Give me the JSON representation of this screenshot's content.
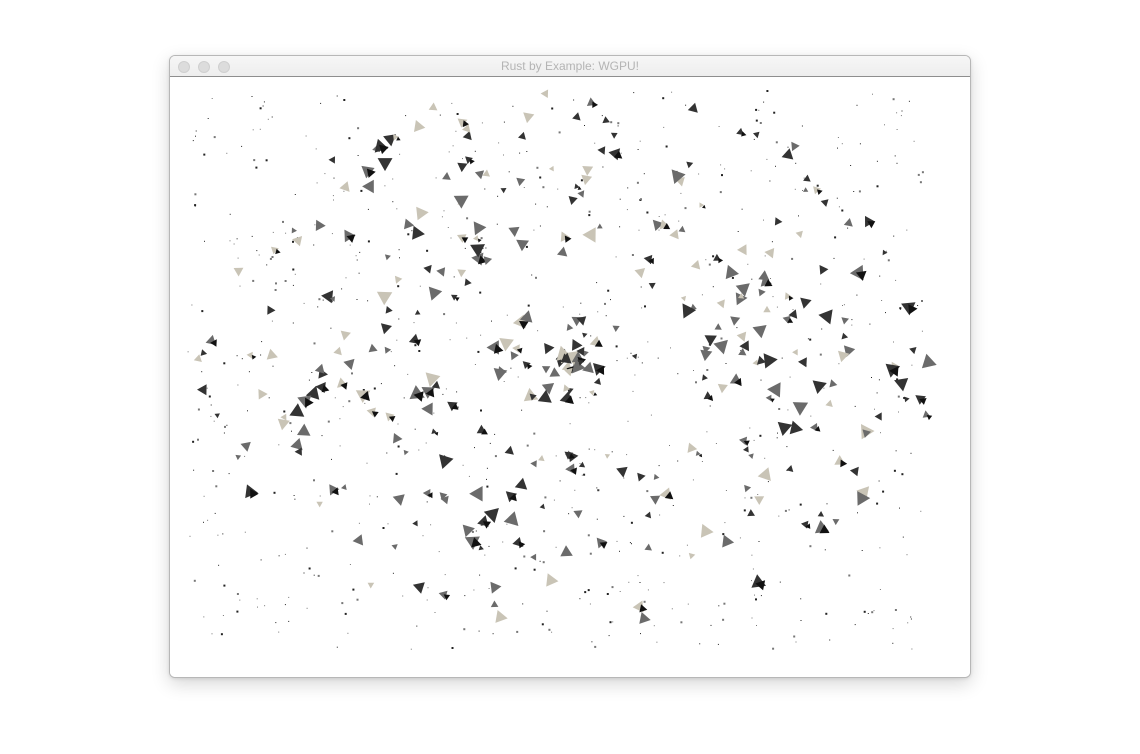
{
  "window": {
    "title": "Rust by Example: WGPU!"
  },
  "colors": {
    "background": "#ffffff",
    "titlebar": "#eeeeee",
    "title_text": "#b4b4b4",
    "traffic_light": "#dcdcdc",
    "window_border": "#8e8e8e",
    "particle_dark": "#333333",
    "particle_mid": "#6b6b6b",
    "particle_light": "#c9c4b6"
  },
  "scene": {
    "kind": "particle-swarm",
    "icon": "triangle-particles"
  }
}
